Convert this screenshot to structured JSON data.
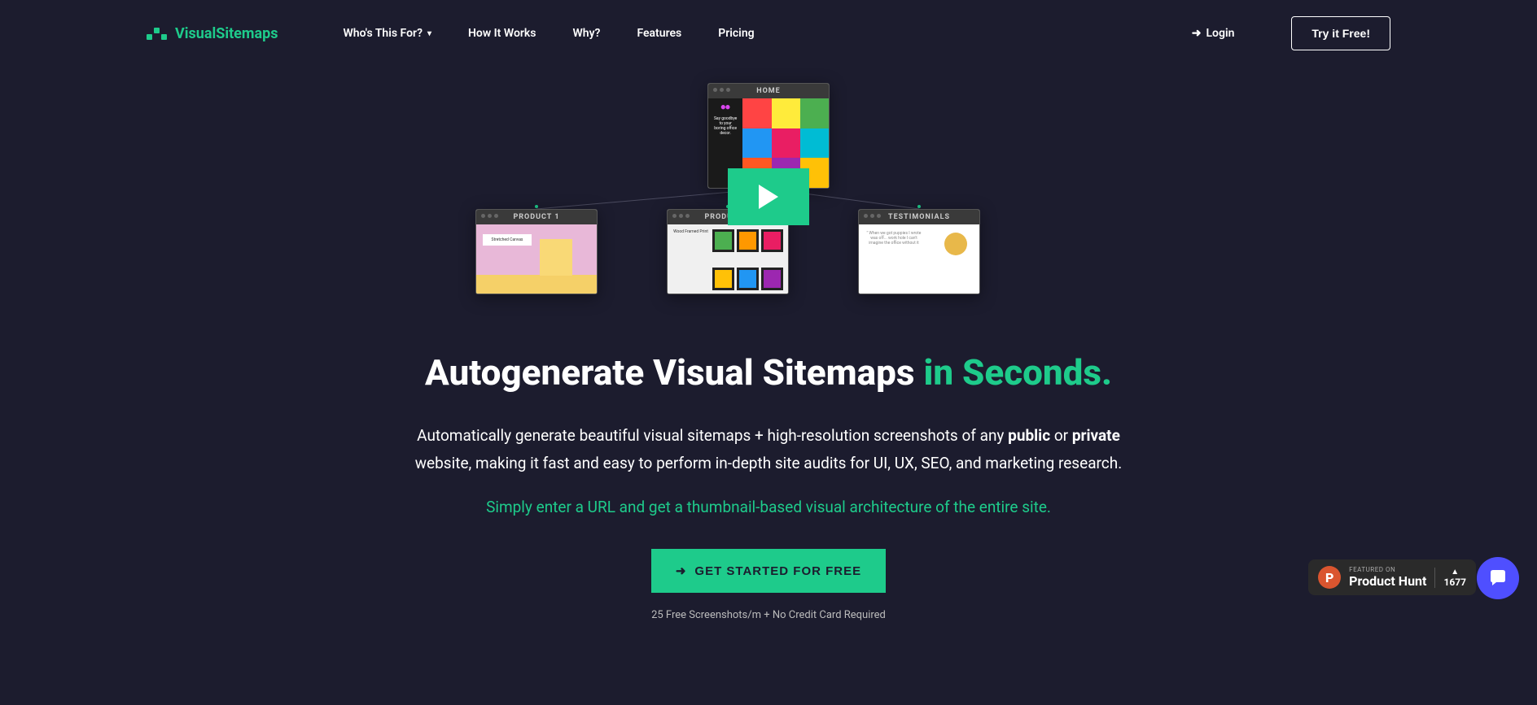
{
  "brand": "VisualSitemaps",
  "nav": {
    "who": "Who's This For?",
    "how": "How It Works",
    "why": "Why?",
    "features": "Features",
    "pricing": "Pricing",
    "login": "Login",
    "tryFree": "Try it Free!"
  },
  "cards": {
    "home": "HOME",
    "product1": "PRODUCT 1",
    "product2": "PRODUCT 2",
    "testimonials": "TESTIMONIALS",
    "homeText1": "Say goodbye to your boring office decor.",
    "p1label": "Stretched Canvas",
    "p2label": "Wood Framed Print"
  },
  "hero": {
    "headline_main": "Autogenerate Visual Sitemaps ",
    "headline_accent": "in Seconds.",
    "desc_part1": "Automatically generate beautiful visual sitemaps + high-resolution screenshots of any ",
    "desc_bold1": "public",
    "desc_part2": " or ",
    "desc_bold2": "private",
    "desc_part3": " website, making it fast and easy to perform in-depth site audits for UI, UX, SEO, and marketing research.",
    "subdesc": "Simply enter a URL and get a thumbnail-based visual architecture of the entire site.",
    "cta": "GET STARTED FOR FREE",
    "cta_note": "25 Free Screenshots/m + No Credit Card Required"
  },
  "productHunt": {
    "featured": "FEATURED ON",
    "name": "Product Hunt",
    "count": "1677"
  }
}
